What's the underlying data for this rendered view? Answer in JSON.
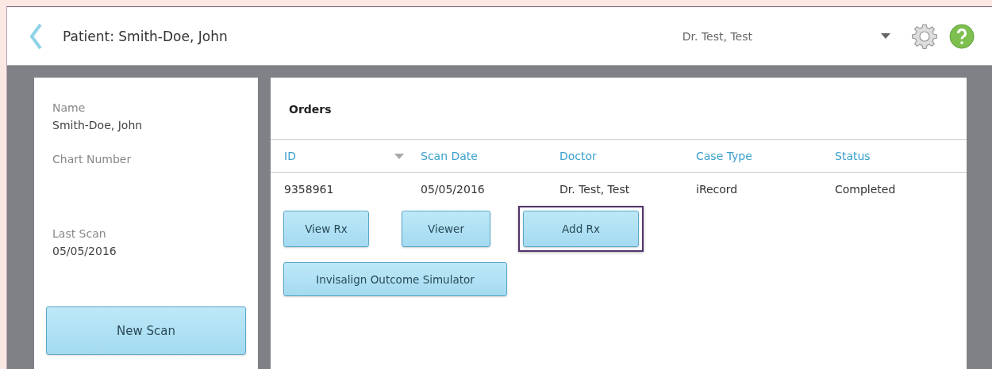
{
  "header": {
    "title": "Patient: Smith-Doe, John",
    "user": "Dr. Test, Test"
  },
  "patient": {
    "fields": [
      {
        "label": "Name",
        "value": "Smith-Doe, John"
      },
      {
        "label": "Chart Number"
      },
      {
        "label": "Last Scan",
        "value": "05/05/2016"
      }
    ],
    "button": "New Scan"
  },
  "orders": {
    "title": "Orders",
    "columns": [
      {
        "label": "ID",
        "sorted": true
      },
      {
        "label": "Scan Date",
        "sorted": false
      },
      {
        "label": "Doctor",
        "sorted": false
      },
      {
        "label": "Case Type",
        "sorted": false
      },
      {
        "label": "Status",
        "sorted": false
      }
    ],
    "rows": [
      [
        "9358961",
        "05/05/2016",
        "Dr. Test, Test",
        "iRecord",
        "Completed"
      ]
    ],
    "buttons": [
      {
        "label": "View Rx",
        "focused": false
      },
      {
        "label": "Viewer",
        "focused": false
      },
      {
        "label": "Add Rx",
        "focused": true
      },
      {
        "label": "Invisalign Outcome Simulator",
        "focused": false
      }
    ]
  }
}
